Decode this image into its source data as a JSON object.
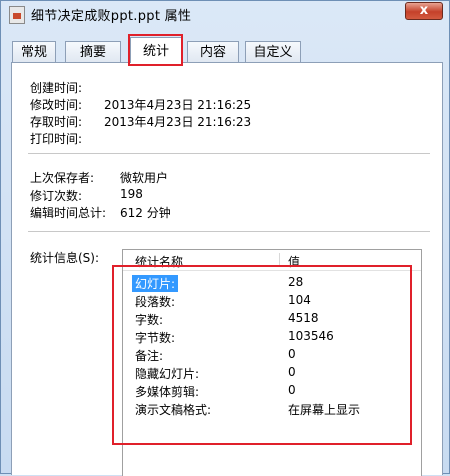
{
  "window": {
    "title": "细节决定成败ppt.ppt 属性",
    "close_label": "x"
  },
  "tabs": [
    "常规",
    "摘要",
    "统计",
    "内容",
    "自定义"
  ],
  "active_tab": "统计",
  "dates": [
    {
      "label": "创建时间:",
      "value": ""
    },
    {
      "label": "修改时间:",
      "value": "2013年4月23日 21:16:25"
    },
    {
      "label": "存取时间:",
      "value": "2013年4月23日 21:16:23"
    },
    {
      "label": "打印时间:",
      "value": ""
    }
  ],
  "info": [
    {
      "label": "上次保存者:",
      "value": "微软用户"
    },
    {
      "label": "修订次数:",
      "value": "198"
    },
    {
      "label": "编辑时间总计:",
      "value": "612 分钟"
    }
  ],
  "stats": {
    "label": "统计信息(S):",
    "header_name": "统计名称",
    "header_value": "值",
    "rows": [
      {
        "name": "幻灯片:",
        "value": "28",
        "selected": true
      },
      {
        "name": "段落数:",
        "value": "104"
      },
      {
        "name": "字数:",
        "value": "4518"
      },
      {
        "name": "字节数:",
        "value": "103546"
      },
      {
        "name": "备注:",
        "value": "0"
      },
      {
        "name": "隐藏幻灯片:",
        "value": "0"
      },
      {
        "name": "多媒体剪辑:",
        "value": "0"
      },
      {
        "name": "演示文稿格式:",
        "value": "在屏幕上显示"
      }
    ]
  },
  "colors": {
    "highlight": "#e0202a",
    "selection": "#3399ff"
  }
}
